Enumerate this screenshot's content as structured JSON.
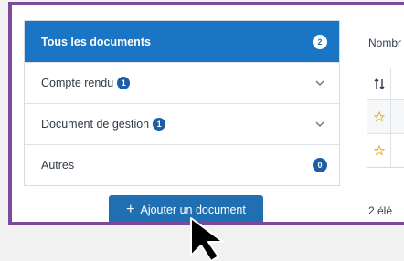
{
  "categories": [
    {
      "label": "Tous les documents",
      "count": "2",
      "active": true,
      "kind": "badge"
    },
    {
      "label": "Compte rendu",
      "inline_count": "1",
      "kind": "chevron"
    },
    {
      "label": "Document de gestion",
      "inline_count": "1",
      "kind": "chevron"
    },
    {
      "label": "Autres",
      "count": "0",
      "kind": "badge"
    }
  ],
  "add_button": {
    "label": "Ajouter un document",
    "icon": "plus-icon"
  },
  "right_pane": {
    "nombre_label": "Nombr",
    "sort_icon": "sort-icon",
    "row_icons": [
      "star-outline-icon",
      "star-outline-icon"
    ],
    "elements_label": "2 élé"
  },
  "colors": {
    "frame": "#7b4a9b",
    "active_bg": "#1a75c4",
    "button_bg": "#1f6fb2",
    "badge_bg": "#1c5ea8",
    "star": "#e2b23a"
  }
}
